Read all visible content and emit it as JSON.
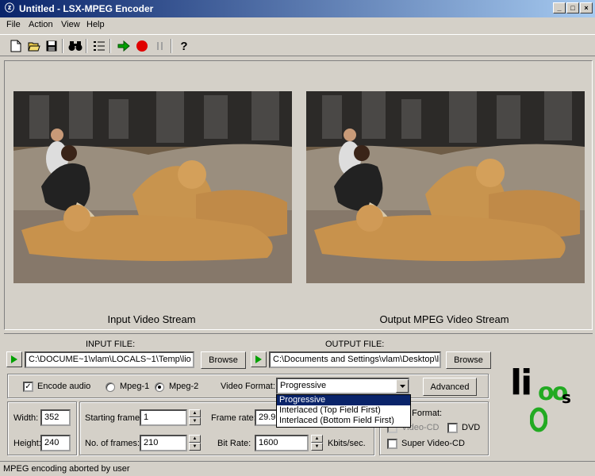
{
  "window": {
    "title": "Untitled - LSX-MPEG Encoder",
    "minimize": "_",
    "maximize": "□",
    "close": "×"
  },
  "menu": {
    "items": [
      "File",
      "Action",
      "View",
      "Help"
    ]
  },
  "toolbar": {
    "icons": [
      "new-file-icon",
      "open-folder-icon",
      "save-icon",
      "binoculars-icon",
      "list-icon",
      "play-arrow-icon",
      "record-icon",
      "pause-icon",
      "help-icon"
    ],
    "help_glyph": "?"
  },
  "video": {
    "input_caption": "Input Video Stream",
    "output_caption": "Output MPEG Video Stream"
  },
  "files": {
    "input_label": "INPUT FILE:",
    "input_value": "C:\\DOCUME~1\\vlam\\LOCALS~1\\Temp\\lio",
    "output_label": "OUTPUT FILE:",
    "output_value": "C:\\Documents and Settings\\vlam\\Desktop\\li",
    "browse_label": "Browse"
  },
  "options": {
    "encode_audio_label": "Encode audio",
    "encode_audio_checked": true,
    "mpeg1_label": "Mpeg-1",
    "mpeg2_label": "Mpeg-2",
    "selected_mpeg": "Mpeg-2",
    "video_format_label": "Video Format:",
    "video_format_value": "Progressive",
    "video_format_options": [
      "Progressive",
      "Interlaced (Top Field First)",
      "Interlaced (Bottom Field First)"
    ],
    "advanced_label": "Advanced"
  },
  "dimensions": {
    "width_label": "Width:",
    "width_value": "352",
    "height_label": "Height:",
    "height_value": "240"
  },
  "frames": {
    "starting_frame_label": "Starting frame:",
    "starting_frame_value": "1",
    "num_frames_label": "No. of frames:",
    "num_frames_value": "210",
    "frame_rate_label": "Frame rate:",
    "frame_rate_value": "29.9",
    "bit_rate_label": "Bit Rate:",
    "bit_rate_value": "1600",
    "bit_rate_unit": "Kbits/sec."
  },
  "output_format": {
    "label": "n Format:",
    "video_cd_label": "Video-CD",
    "dvd_label": "DVD",
    "super_video_cd_label": "Super Video-CD"
  },
  "logo": {
    "text_top": "li",
    "text_o": "oo",
    "text_s": "s"
  },
  "status": {
    "text": "MPEG encoding aborted by user"
  },
  "colors": {
    "title_bar": "#0a246a",
    "record": "#e00000",
    "play": "#00a000",
    "logo_green": "#22aa22"
  }
}
